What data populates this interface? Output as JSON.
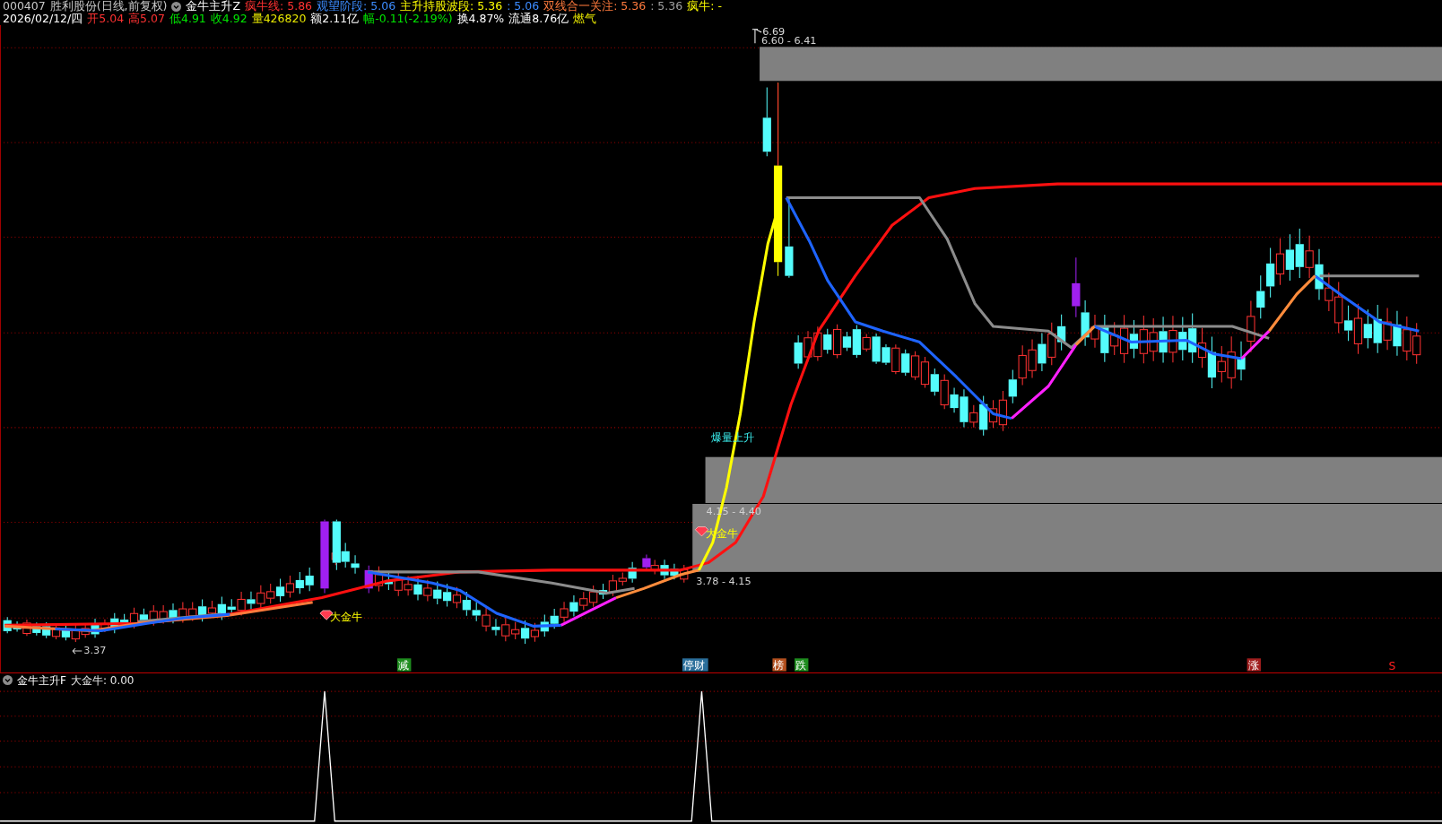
{
  "header": {
    "code": "000407",
    "title": "胜利股份(日线,前复权)",
    "indicator": "金牛主升Z",
    "indicator_values": [
      {
        "text": "疯牛线: 5.86",
        "color": "#ff3232"
      },
      {
        "text": "观望阶段: 5.06",
        "color": "#3c8cff"
      },
      {
        "text": "主升持股波段: 5.36",
        "color": "#ffff00"
      },
      {
        "text": ": 5.06",
        "color": "#3c8cff"
      },
      {
        "text": "双线合一关注: 5.36",
        "color": "#ff7a3c"
      },
      {
        "text": ": 5.36",
        "color": "#a0a0a0"
      },
      {
        "text": "疯牛: -",
        "color": "#ffff00"
      }
    ]
  },
  "quote": [
    {
      "text": "2026/02/12/四",
      "color": "#ffffff"
    },
    {
      "text": "开5.04",
      "color": "#ff3232"
    },
    {
      "text": "高5.07",
      "color": "#ff3232"
    },
    {
      "text": "低4.91",
      "color": "#00e600"
    },
    {
      "text": "收4.92",
      "color": "#00e600"
    },
    {
      "text": "量426820",
      "color": "#e6e600"
    },
    {
      "text": "额2.11亿",
      "color": "#ffffff"
    },
    {
      "text": "幅-0.11(-2.19%)",
      "color": "#00e600"
    },
    {
      "text": "换4.87%",
      "color": "#ffffff"
    },
    {
      "text": "流通8.76亿",
      "color": "#ffffff"
    },
    {
      "text": "燃气",
      "color": "#e6e600"
    }
  ],
  "chart": {
    "labels": [
      {
        "text": "6.69",
        "kind": "max"
      },
      {
        "text": "6.60 - 6.41",
        "kind": "zone"
      },
      {
        "text": "爆量上升",
        "kind": "signal"
      },
      {
        "text": "4.15 - 4.40",
        "kind": "zone"
      },
      {
        "text": "大金牛",
        "kind": "gem"
      },
      {
        "text": "大金牛",
        "kind": "gem"
      },
      {
        "text": "3.78 - 4.15",
        "kind": "zone"
      },
      {
        "text": "3.37",
        "kind": "min"
      }
    ],
    "signal_tags": [
      {
        "text": "减",
        "kind": "box",
        "color": "#1e8c1e"
      },
      {
        "text": "停财",
        "kind": "box",
        "color": "#2a6e9a"
      },
      {
        "text": "榜",
        "kind": "box",
        "color": "#b4501e"
      },
      {
        "text": "跌",
        "kind": "box",
        "color": "#1e8c1e"
      },
      {
        "text": "涨",
        "kind": "box",
        "color": "#a01e1e"
      },
      {
        "text": "S",
        "kind": "glyph",
        "color": "#ff2020"
      }
    ]
  },
  "sub_panel": {
    "indicator": "金牛主升F",
    "value": "大金牛: 0.00"
  }
}
